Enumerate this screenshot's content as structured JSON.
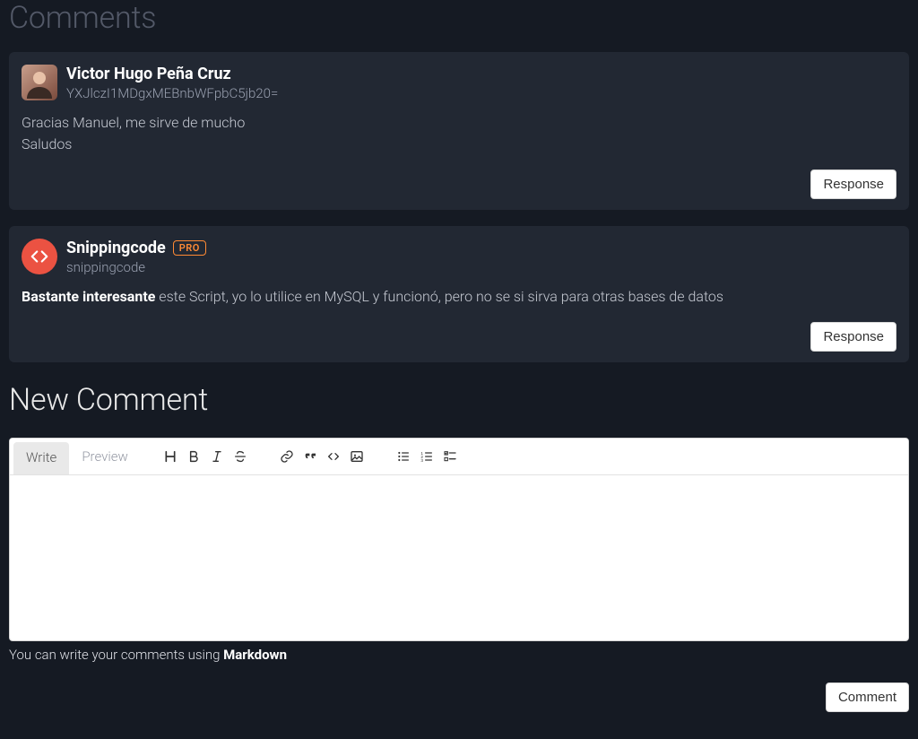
{
  "comments_section": {
    "title": "Comments",
    "items": [
      {
        "author_name": "Victor Hugo Peña Cruz",
        "author_handle": "YXJlczI1MDgxMEBnbWFpbC5jb20=",
        "avatar_kind": "user",
        "badge": "",
        "body_html": "Gracias Manuel, me sirve de mucho<br>Saludos",
        "response_label": "Response"
      },
      {
        "author_name": "Snippingcode",
        "author_handle": "snippingcode",
        "avatar_kind": "brand",
        "badge": "PRO",
        "body_html": "<strong>Bastante interesante</strong> este Script, yo lo utilice en MySQL y funcionó, pero no se si sirva para otras bases de datos",
        "response_label": "Response"
      }
    ]
  },
  "new_comment": {
    "title": "New Comment",
    "tabs": {
      "write": "Write",
      "preview": "Preview"
    },
    "hint_prefix": "You can write your comments using ",
    "hint_strong": "Markdown",
    "submit": "Comment"
  },
  "toolbar_icons": [
    "header-icon",
    "bold-icon",
    "italic-icon",
    "strike-icon",
    "link-icon",
    "quote-icon",
    "code-icon",
    "image-icon",
    "ul-icon",
    "ol-icon",
    "tasklist-icon"
  ]
}
